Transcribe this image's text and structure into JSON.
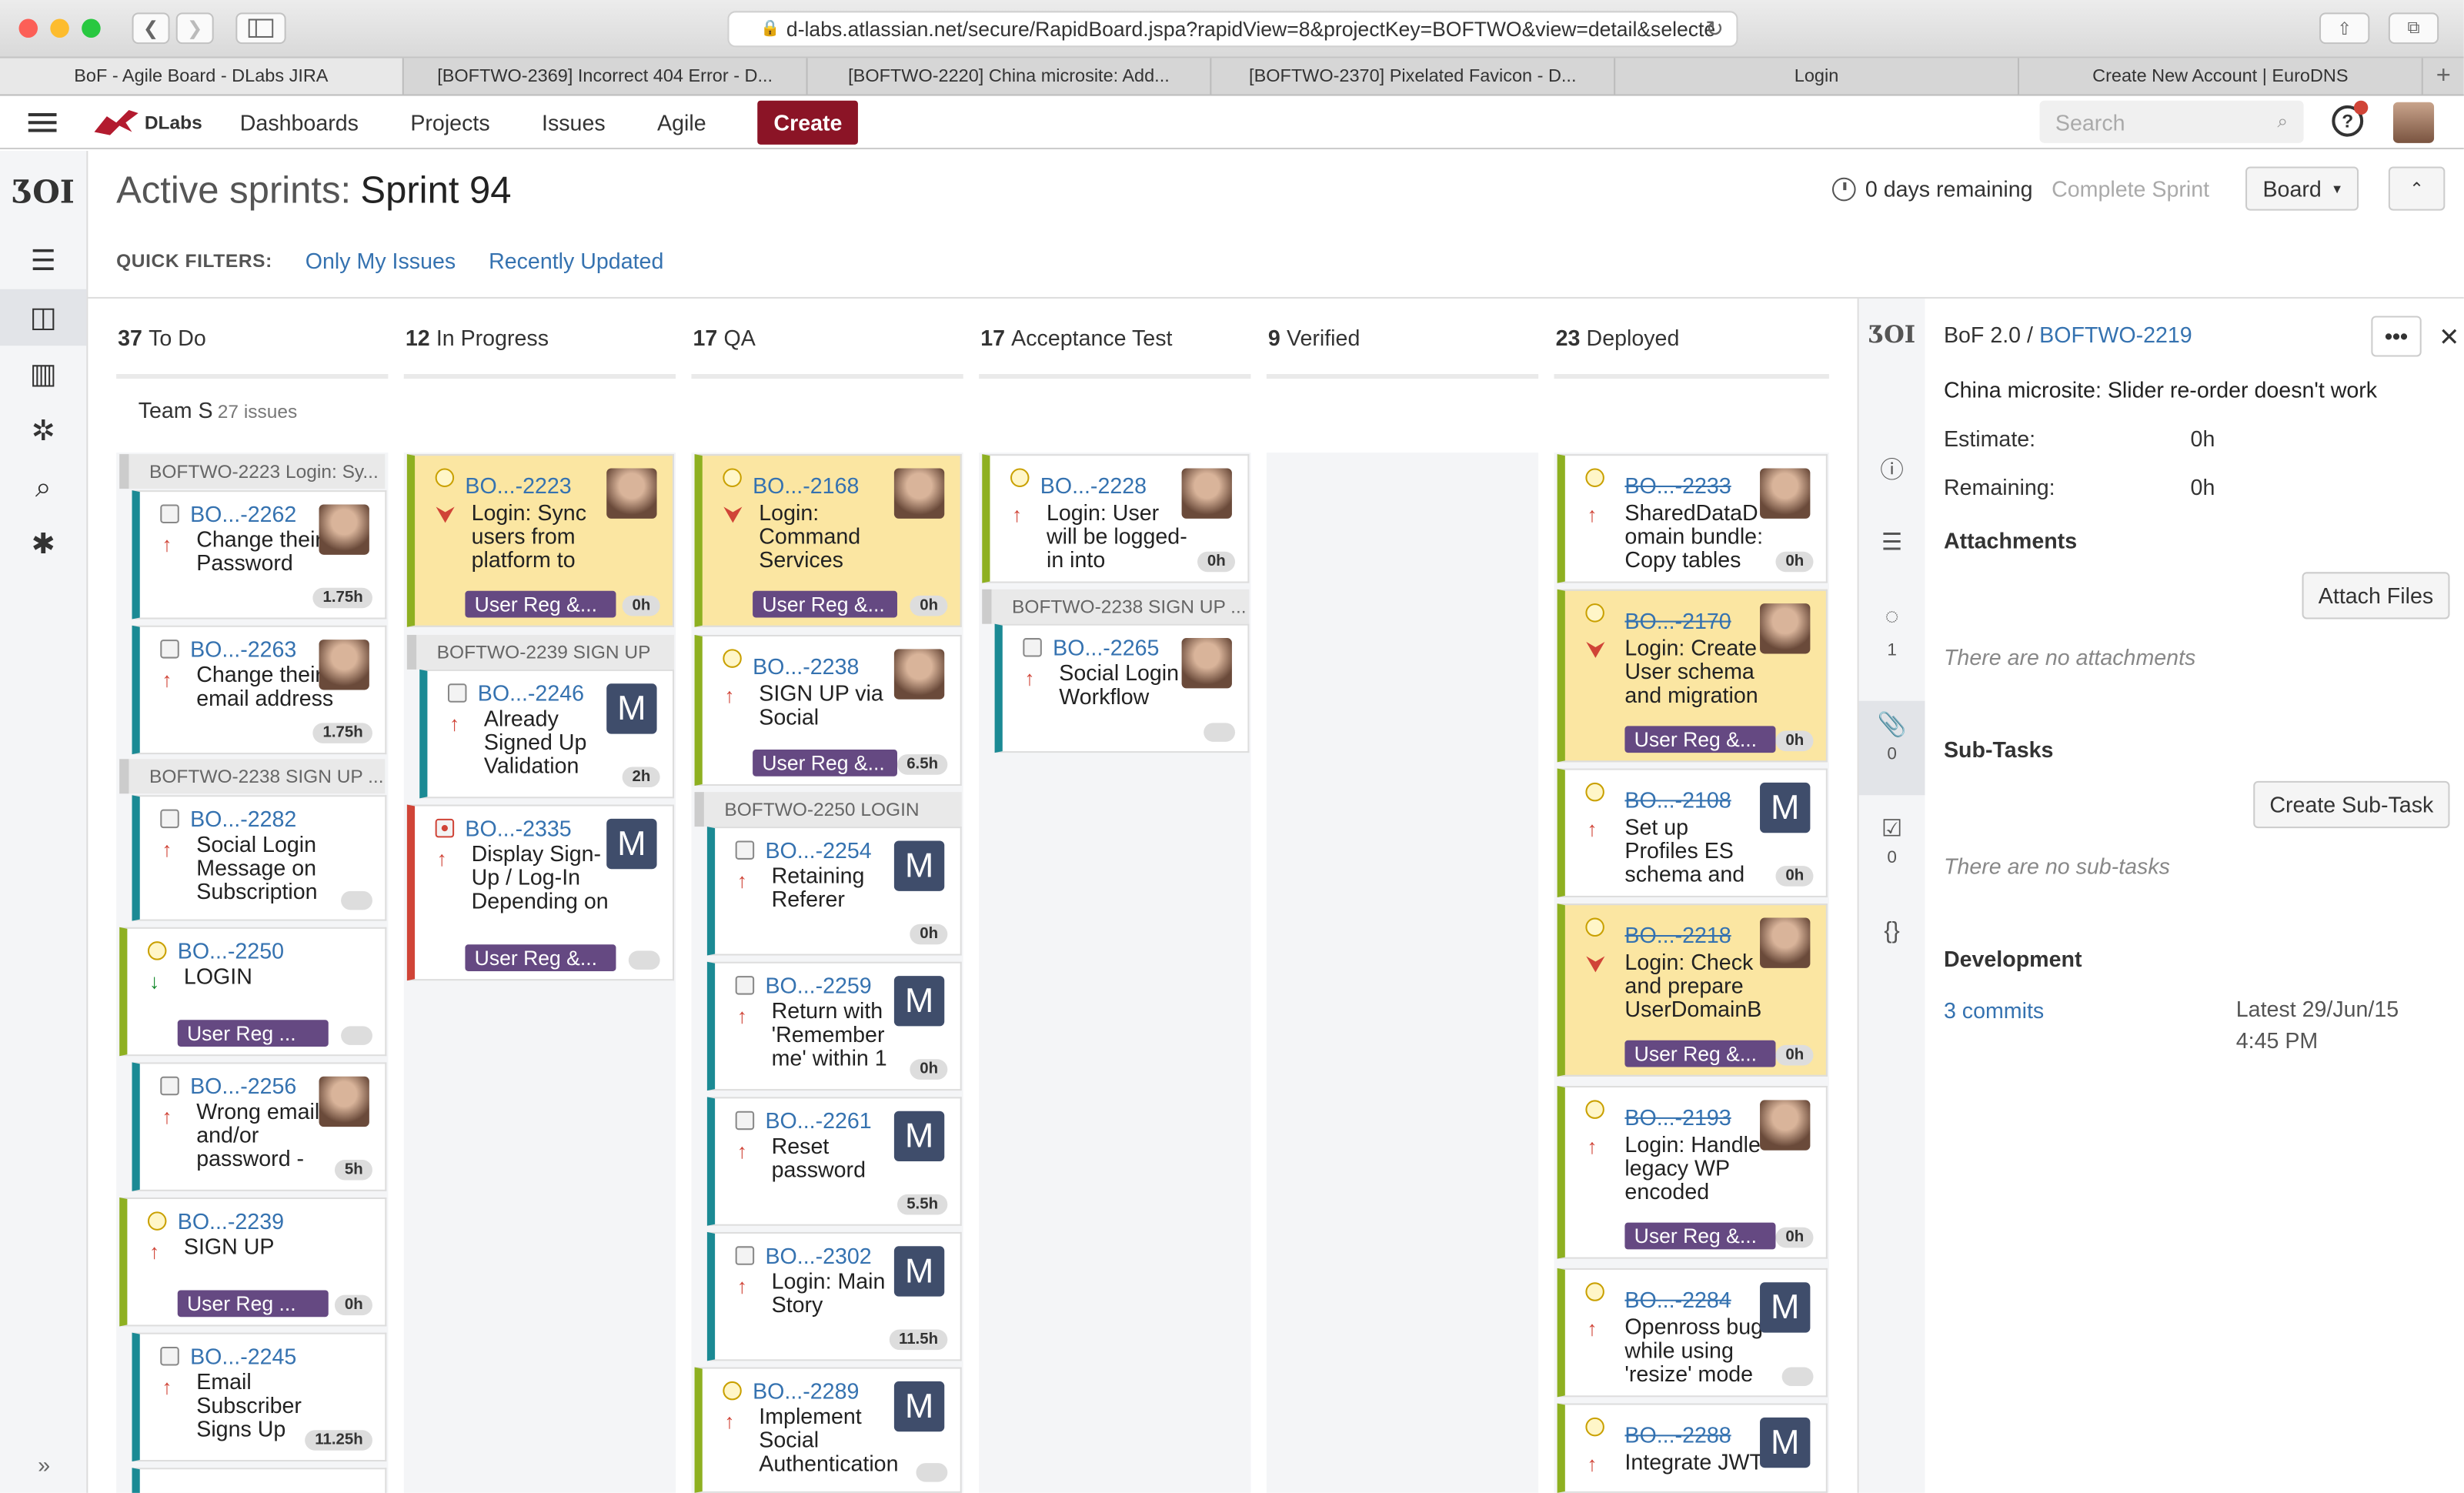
{
  "browser": {
    "url": "d-labs.atlassian.net/secure/RapidBoard.jspa?rapidView=8&projectKey=BOFTWO&view=detail&selecte",
    "tabs": [
      "BoF - Agile Board - DLabs JIRA",
      "[BOFTWO-2369] Incorrect 404 Error - D...",
      "[BOFTWO-2220] China microsite: Add...",
      "[BOFTWO-2370] Pixelated Favicon - D...",
      "Login",
      "Create New Account | EuroDNS"
    ]
  },
  "header": {
    "logo": "DLabs",
    "nav": [
      "Dashboards",
      "Projects",
      "Issues",
      "Agile"
    ],
    "create": "Create",
    "search_placeholder": "Search",
    "help": "?"
  },
  "board": {
    "title_prefix": "Active sprints:",
    "sprint": "Sprint 94",
    "quick_filters_label": "QUICK FILTERS:",
    "filters": [
      "Only My Issues",
      "Recently Updated"
    ],
    "remaining": "0 days remaining",
    "complete": "Complete Sprint",
    "board_btn": "Board",
    "swimlane": "Team S",
    "swimlane_count": "27 issues",
    "columns": [
      {
        "count": "37",
        "name": "To Do"
      },
      {
        "count": "12",
        "name": "In Progress"
      },
      {
        "count": "17",
        "name": "QA"
      },
      {
        "count": "17",
        "name": "Acceptance Test"
      },
      {
        "count": "9",
        "name": "Verified"
      },
      {
        "count": "23",
        "name": "Deployed"
      }
    ]
  },
  "groups": {
    "g1": "BOFTWO-2223  Login: Sy...",
    "g2": "BOFTWO-2238  SIGN UP ...",
    "g3": "BOFTWO-2239  SIGN UP",
    "g4": "BOFTWO-2250  LOGIN",
    "g5": "BOFTWO-2238  SIGN UP ..."
  },
  "cards": {
    "c2262": {
      "key": "BO...-2262",
      "title": "Change their Password",
      "est": "1.75h"
    },
    "c2263": {
      "key": "BO...-2263",
      "title": "Change their email address",
      "est": "1.75h"
    },
    "c2282": {
      "key": "BO...-2282",
      "title": "Social Login Message on Subscription"
    },
    "c2250": {
      "key": "BO...-2250",
      "title": "LOGIN",
      "epic": "User Reg ..."
    },
    "c2256": {
      "key": "BO...-2256",
      "title": "Wrong email and/or password -",
      "est": "5h"
    },
    "c2239": {
      "key": "BO...-2239",
      "title": "SIGN UP",
      "epic": "User Reg ...",
      "est": "0h"
    },
    "c2245": {
      "key": "BO...-2245",
      "title": "Email Subscriber Signs Up",
      "est": "11.25h"
    },
    "c2223": {
      "key": "BO...-2223",
      "title": "Login: Sync users from platform to",
      "epic": "User Reg &...",
      "est": "0h"
    },
    "c2246": {
      "key": "BO...-2246",
      "title": "Already Signed Up Validation",
      "est": "2h",
      "avatar": "M"
    },
    "c2335": {
      "key": "BO...-2335",
      "title": "Display Sign-Up / Log-In Depending on",
      "epic": "User Reg &...",
      "avatar": "M"
    },
    "c2168": {
      "key": "BO...-2168",
      "title": "Login: Command Services",
      "epic": "User Reg &...",
      "est": "0h"
    },
    "c2238": {
      "key": "BO...-2238",
      "title": "SIGN UP via Social",
      "epic": "User Reg &...",
      "est": "6.5h"
    },
    "c2254": {
      "key": "BO...-2254",
      "title": "Retaining Referer",
      "est": "0h",
      "avatar": "M"
    },
    "c2259": {
      "key": "BO...-2259",
      "title": "Return with 'Remember me' within 1",
      "est": "0h",
      "avatar": "M"
    },
    "c2261": {
      "key": "BO...-2261",
      "title": "Reset password",
      "est": "5.5h",
      "avatar": "M"
    },
    "c2302": {
      "key": "BO...-2302",
      "title": "Login: Main Story",
      "est": "11.5h",
      "avatar": "M"
    },
    "c2289": {
      "key": "BO...-2289",
      "title": "Implement Social Authentication",
      "avatar": "M"
    },
    "c2228": {
      "key": "BO...-2228",
      "title": "Login: User will be logged-in into",
      "est": "0h"
    },
    "c2265": {
      "key": "BO...-2265",
      "title": "Social Login Workflow"
    },
    "c2233": {
      "key": "BO...-2233",
      "title": "SharedDataD omain bundle: Copy tables",
      "est": "0h"
    },
    "c2170": {
      "key": "BO...-2170",
      "title": "Login: Create User schema and migration",
      "epic": "User Reg &...",
      "est": "0h"
    },
    "c2108": {
      "key": "BO...-2108",
      "title": "Set up Profiles ES schema and",
      "est": "0h",
      "avatar": "M"
    },
    "c2218": {
      "key": "BO...-2218",
      "title": "Login: Check and prepare UserDomainB",
      "epic": "User Reg &...",
      "est": "0h"
    },
    "c2193": {
      "key": "BO...-2193",
      "title": "Login: Handle legacy WP encoded",
      "epic": "User Reg &...",
      "est": "0h"
    },
    "c2284": {
      "key": "BO...-2284",
      "title": "Openross bug while using 'resize' mode",
      "avatar": "M"
    },
    "c2288": {
      "key": "BO...-2288",
      "title": "Integrate JWT",
      "avatar": "M"
    }
  },
  "detail": {
    "project": "BoF 2.0 /",
    "key": "BOFTWO-2219",
    "summary": "China microsite: Slider re-order doesn't work",
    "estimate_label": "Estimate:",
    "estimate": "0h",
    "remaining_label": "Remaining:",
    "remaining": "0h",
    "attachments": "Attachments",
    "attach_btn": "Attach Files",
    "no_attach": "There are no attachments",
    "subtasks": "Sub-Tasks",
    "create_sub": "Create Sub-Task",
    "no_sub": "There are no sub-tasks",
    "development": "Development",
    "commits": "3 commits",
    "latest": "Latest 29/Jun/15 4:45 PM",
    "comments_count": "1",
    "attach_count": "0",
    "sub_count": "0"
  }
}
